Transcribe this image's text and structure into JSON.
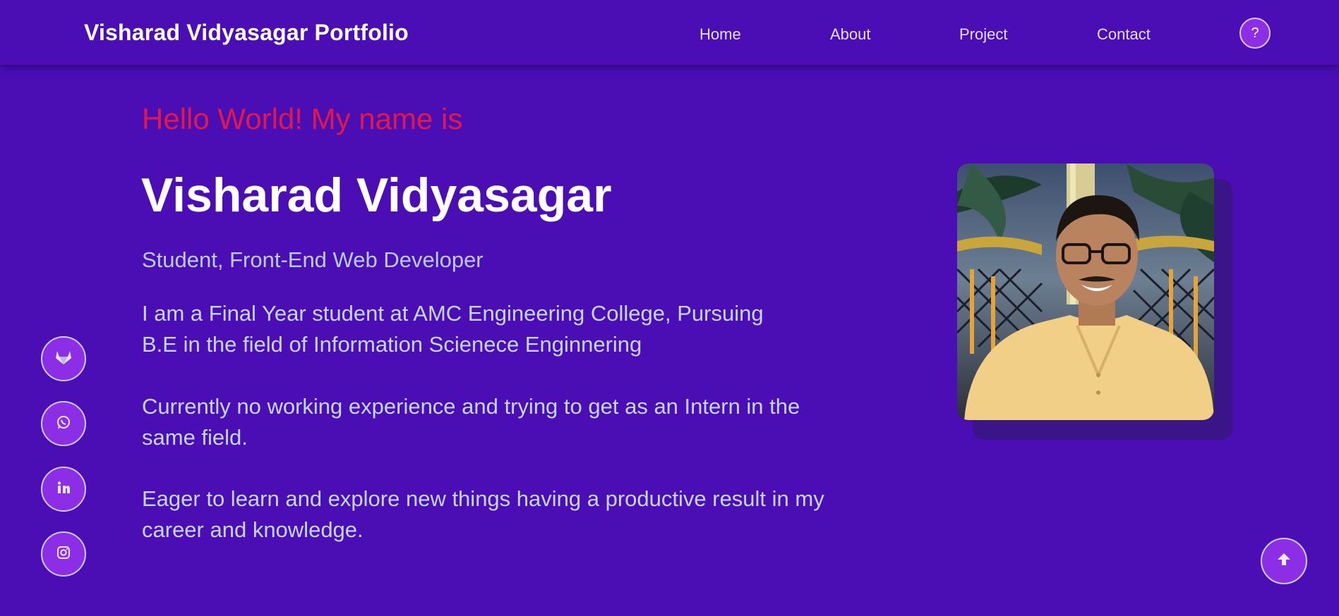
{
  "header": {
    "brand": "Visharad Vidyasagar Portfolio",
    "nav": [
      "Home",
      "About",
      "Project",
      "Contact"
    ],
    "help_label": "?"
  },
  "hero": {
    "greeting": "Hello World! My name is",
    "name": "Visharad Vidyasagar",
    "subtitle": "Student, Front-End Web Developer",
    "paragraphs": [
      "I am a Final Year student at AMC Engineering College, Pursuing B.E in the field of Information Scienece Enginnering",
      "Currently no working experience and trying to get as an Intern in the same field.",
      "Eager to learn and explore new things having a productive result in my career and knowledge."
    ]
  },
  "social": {
    "icons": [
      "gitlab-icon",
      "whatsapp-icon",
      "linkedin-icon",
      "instagram-icon"
    ]
  },
  "scroll_top": {
    "icon": "arrow-up-icon"
  },
  "colors": {
    "background": "#4a0eb4",
    "greeting": "#e1194a",
    "body_text": "#c6d7ff",
    "button": "#8c2ee6"
  }
}
